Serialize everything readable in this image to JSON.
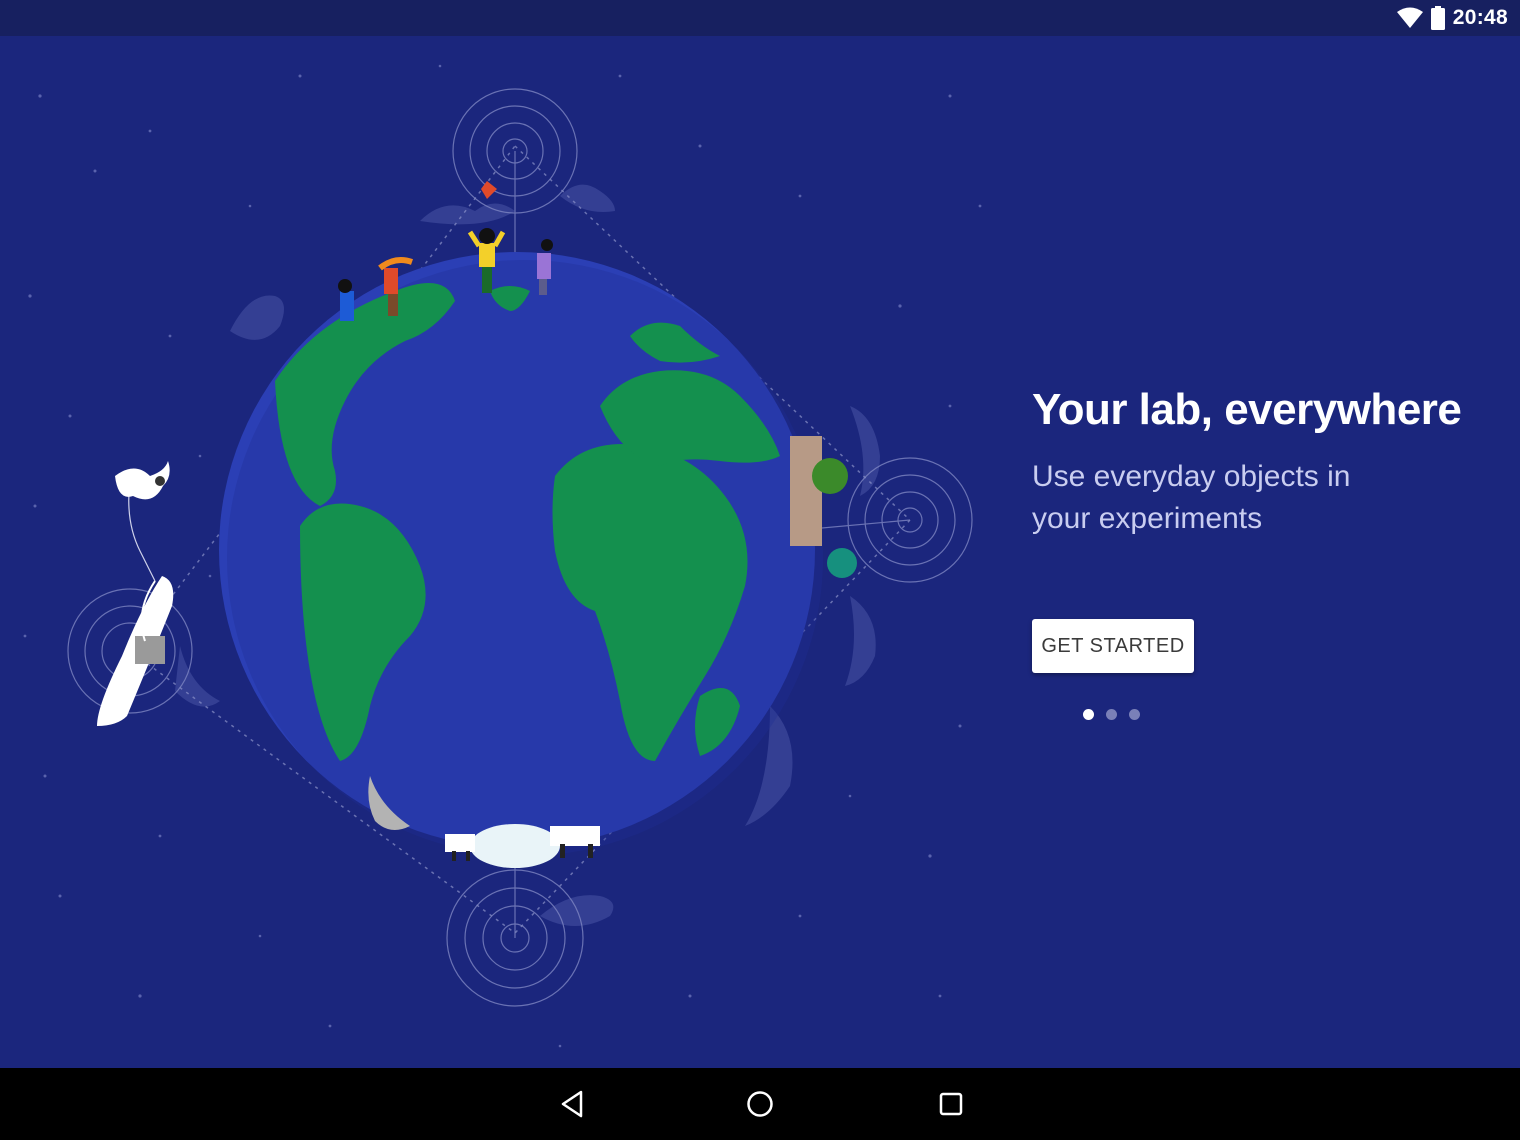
{
  "status_bar": {
    "time": "20:48",
    "icons": [
      "wifi-icon",
      "battery-icon"
    ]
  },
  "onboarding": {
    "title": "Your lab, everywhere",
    "subtitle": "Use everyday objects in your experiments",
    "cta_label": "GET STARTED",
    "page_count": 3,
    "current_page": 1
  },
  "illustration": {
    "subject": "globe-with-people-and-sensors"
  },
  "navigation": {
    "buttons": [
      "back-icon",
      "home-icon",
      "recents-icon"
    ]
  },
  "colors": {
    "background": "#1b267d",
    "status_bar": "#172060",
    "ocean": "#2b3fb5",
    "land": "#14904e",
    "button_bg": "#ffffff",
    "title": "#ffffff",
    "subtitle": "#c9cdf0"
  }
}
